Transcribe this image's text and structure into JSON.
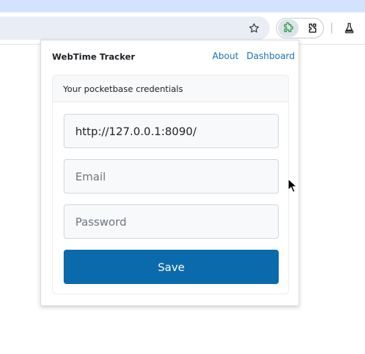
{
  "browser": {
    "toolbar": {
      "star_icon": "star-icon",
      "extension_icon": "puzzle-icon",
      "extensions_menu_icon": "extensions-icon",
      "labs_icon": "flask-icon"
    }
  },
  "popup": {
    "title": "WebTime Tracker",
    "links": {
      "about": "About",
      "dashboard": "Dashboard"
    },
    "card": {
      "header": "Your pocketbase credentials",
      "url_value": "http://127.0.0.1:8090/",
      "email_placeholder": "Email",
      "password_placeholder": "Password",
      "save_label": "Save"
    }
  },
  "colors": {
    "accent": "#0b6aab",
    "link": "#1a73b8",
    "tabstrip": "#d3e3fd"
  }
}
